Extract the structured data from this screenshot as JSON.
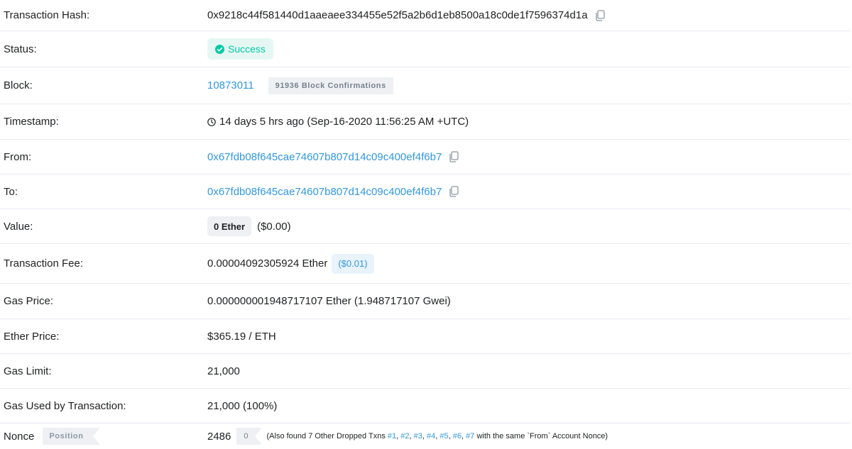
{
  "rows": {
    "tx_hash": {
      "label": "Transaction Hash:",
      "value": "0x9218c44f581440d1aaeaee334455e52f5a2b6d1eb8500a18c0de1f7596374d1a"
    },
    "status": {
      "label": "Status:",
      "value": "Success",
      "color": "#00c9a7"
    },
    "block": {
      "label": "Block:",
      "number": "10873011",
      "confirmations": "91936 Block Confirmations"
    },
    "timestamp": {
      "label": "Timestamp:",
      "value": "14 days 5 hrs ago (Sep-16-2020 11:56:25 AM +UTC)"
    },
    "from": {
      "label": "From:",
      "value": "0x67fdb08f645cae74607b807d14c09c400ef4f6b7"
    },
    "to": {
      "label": "To:",
      "value": "0x67fdb08f645cae74607b807d14c09c400ef4f6b7"
    },
    "value": {
      "label": "Value:",
      "ether": "0 Ether",
      "usd": "($0.00)"
    },
    "fee": {
      "label": "Transaction Fee:",
      "ether": "0.00004092305924 Ether",
      "usd": "($0.01)"
    },
    "gas_price": {
      "label": "Gas Price:",
      "value": "0.000000001948717107 Ether (1.948717107 Gwei)"
    },
    "ether_price": {
      "label": "Ether Price:",
      "value": "$365.19 / ETH"
    },
    "gas_limit": {
      "label": "Gas Limit:",
      "value": "21,000"
    },
    "gas_used": {
      "label": "Gas Used by Transaction:",
      "value": "21,000 (100%)"
    },
    "nonce": {
      "label": "Nonce",
      "position_tag": "Position",
      "value": "2486",
      "position": "0",
      "note_prefix": "(Also found 7 Other Dropped Txns",
      "links": [
        "#1",
        "#2",
        "#3",
        "#4",
        "#5",
        "#6",
        "#7"
      ],
      "note_suffix": "with the same `From` Account Nonce)"
    }
  },
  "colors": {
    "link": "#3498db",
    "success": "#00c9a7",
    "divider": "#e7eaf3"
  }
}
